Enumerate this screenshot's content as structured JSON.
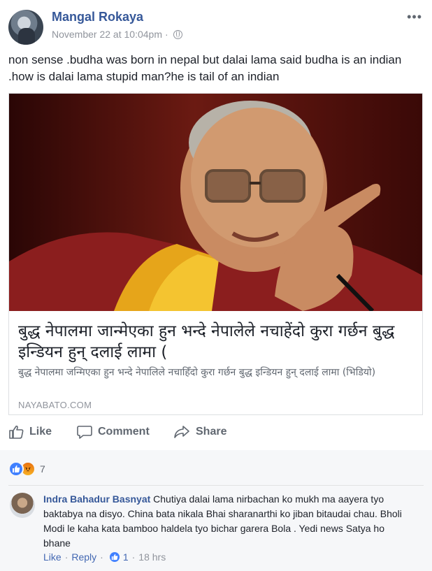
{
  "post": {
    "author": "Mangal Rokaya",
    "timestamp": "November 22 at 10:04pm",
    "audience_separator": "·",
    "audience_icon": "globe-icon",
    "more_icon": "•••",
    "text": "non sense .budha was born in nepal but dalai lama said budha is an indian .how is dalai lama stupid man?he is tail of an indian"
  },
  "link_preview": {
    "title": "बुद्ध नेपालमा जान्मेएका हुन भन्दे नेपालेले नचाहेंदो कुरा गर्छन बुद्ध इन्डियन हुन् दलाई लामा (",
    "description": "बुद्ध नेपालमा जन्मिएका हुन भन्दे नेपालिले नचाहिँदो कुरा गर्छन बुद्ध इन्डियन हुन् दलाई लामा (भिडियो)",
    "domain": "NAYABATO.COM"
  },
  "actions": {
    "like": "Like",
    "comment": "Comment",
    "share": "Share"
  },
  "reactions": {
    "count": "7",
    "types": [
      "like",
      "angry"
    ]
  },
  "comment": {
    "author": "Indra Bahadur Basnyat",
    "text": " Chutiya dalai lama nirbachan ko mukh ma aayera tyo baktabya na disyo. China bata nikala Bhai sharanarthi ko jiban bitaudai chau. Bholi Modi le kaha kata bamboo haldela tyo bichar garera Bola . Yedi news Satya ho bhane",
    "like_label": "Like",
    "reply_label": "Reply",
    "separator": "·",
    "like_count": "1",
    "time": "18 hrs"
  },
  "colors": {
    "link_blue": "#365899",
    "like_blue": "#4080ff",
    "gray_text": "#90949c",
    "reaction_bg": "#f6f7f9"
  }
}
